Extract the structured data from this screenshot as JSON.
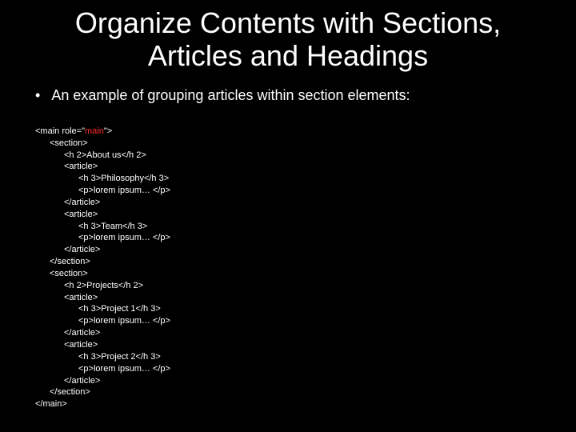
{
  "title": "Organize Contents with Sections, Articles and Headings",
  "bullet": "An example of grouping articles within section elements:",
  "code": {
    "l0": "<main role=\"",
    "l0b": "main",
    "l0c": "\">",
    "l1": "<section>",
    "l2": "<h 2>About us</h 2>",
    "l3": "<article>",
    "l4": "<h 3>Philosophy</h 3>",
    "l5": "<p>lorem ipsum… </p>",
    "l6": "</article>",
    "l7": "<article>",
    "l8": "<h 3>Team</h 3>",
    "l9": "<p>lorem ipsum… </p>",
    "l10": "</article>",
    "l11": "</section>",
    "l12": "<section>",
    "l13": "<h 2>Projects</h 2>",
    "l14": "<article>",
    "l15": "<h 3>Project 1</h 3>",
    "l16": "<p>lorem ipsum… </p>",
    "l17": "</article>",
    "l18": "<article>",
    "l19": "<h 3>Project 2</h 3>",
    "l20": "<p>lorem ipsum… </p>",
    "l21": "</article>",
    "l22": "</section>",
    "l23": "</main>"
  }
}
